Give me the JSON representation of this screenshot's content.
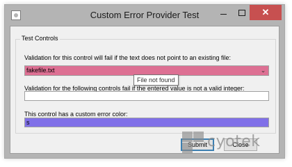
{
  "window": {
    "title": "Custom Error Provider Test",
    "close_glyph": "✕",
    "dropdown_glyph": "⌄"
  },
  "group": {
    "legend": "Test Controls"
  },
  "fields": {
    "file_label": "Validation for this control will fail if the text does not point to an existing file:",
    "file_value": "fakefile.txt",
    "file_error_color": "#dd7093",
    "tooltip": "File not found",
    "integer_label": "Validation for the following controls fail if the entered value is not a valid integer:",
    "integer_value": "",
    "custom_label": "This control has a custom error color:",
    "custom_value": "s",
    "custom_error_color": "#8070e8"
  },
  "buttons": {
    "submit": "Submit",
    "close": "Close"
  },
  "watermark": {
    "text": "cyotek"
  }
}
